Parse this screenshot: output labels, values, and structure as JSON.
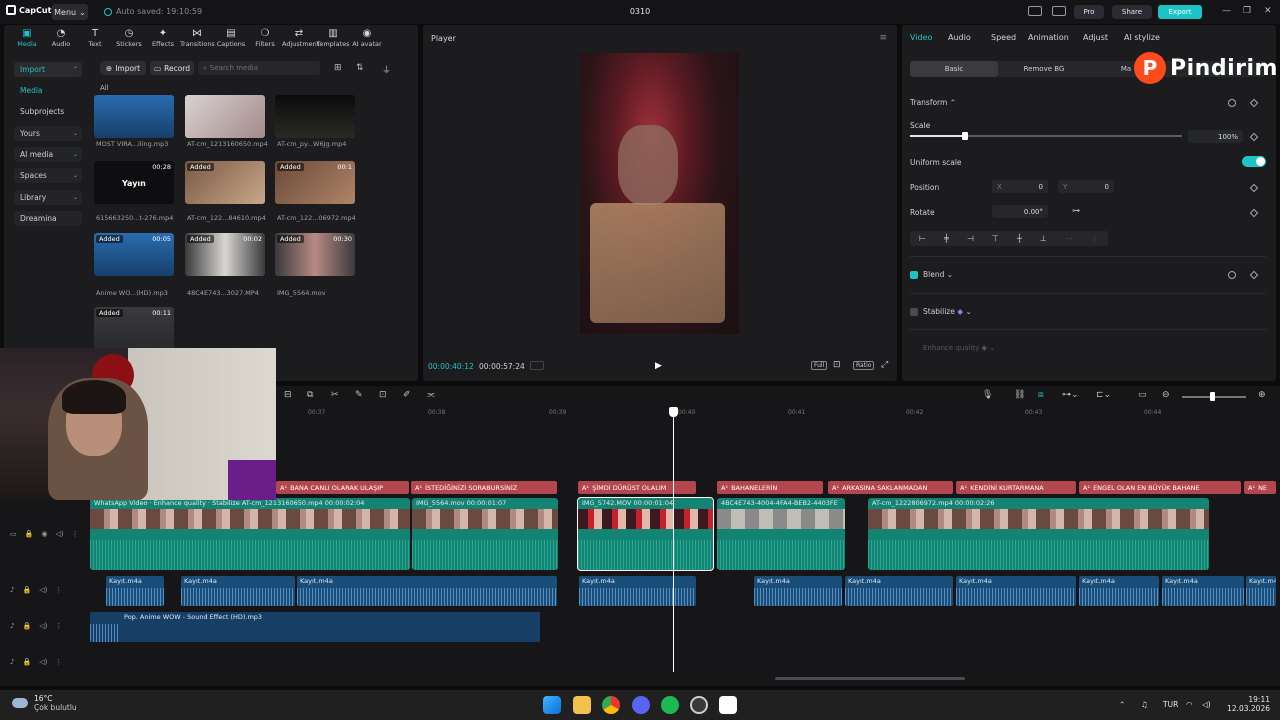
{
  "titlebar": {
    "app_name": "CapCut",
    "menu_label": "Menu",
    "autosave": "Auto saved: 19:10:59",
    "project_name": "0310",
    "pro_label": "Pro",
    "share_label": "Share",
    "export_label": "Export"
  },
  "media_tools": [
    {
      "label": "Media",
      "icon": "media-icon",
      "glyph": "▣"
    },
    {
      "label": "Audio",
      "icon": "audio-icon",
      "glyph": "◔"
    },
    {
      "label": "Text",
      "icon": "text-icon",
      "glyph": "T"
    },
    {
      "label": "Stickers",
      "icon": "stickers-icon",
      "glyph": "◷"
    },
    {
      "label": "Effects",
      "icon": "effects-icon",
      "glyph": "✦"
    },
    {
      "label": "Transitions",
      "icon": "transitions-icon",
      "glyph": "⋈"
    },
    {
      "label": "Captions",
      "icon": "captions-icon",
      "glyph": "▤"
    },
    {
      "label": "Filters",
      "icon": "filters-icon",
      "glyph": "❍"
    },
    {
      "label": "Adjustment",
      "icon": "adjustment-icon",
      "glyph": "⇄"
    },
    {
      "label": "Templates",
      "icon": "templates-icon",
      "glyph": "▥"
    },
    {
      "label": "AI avatar",
      "icon": "ai-avatar-icon",
      "glyph": "◉"
    }
  ],
  "sidebar": {
    "items": [
      {
        "label": "Import"
      },
      {
        "label": "Media"
      },
      {
        "label": "Subprojects"
      },
      {
        "label": "Yours"
      },
      {
        "label": "AI media"
      },
      {
        "label": "Spaces"
      },
      {
        "label": "Library"
      },
      {
        "label": "Dreamina"
      }
    ]
  },
  "media": {
    "import_label": "Import",
    "record_label": "Record",
    "search_placeholder": "Search media",
    "filter_all": "All",
    "items": [
      {
        "name": "MOST VIRA...iling.mp3",
        "badge": "",
        "duration": ""
      },
      {
        "name": "AT-cm_1213160650.mp4",
        "badge": "",
        "duration": ""
      },
      {
        "name": "AT-cm_py...W6Jg.mp4",
        "badge": "",
        "duration": ""
      },
      {
        "name": "615663250...t-276.mp4",
        "badge": "",
        "duration": "00:28"
      },
      {
        "name": "AT-cm_122...84610.mp4",
        "badge": "Added",
        "duration": ""
      },
      {
        "name": "AT-cm_122...06972.mp4",
        "badge": "Added",
        "duration": "00:1"
      },
      {
        "name": "Anime WO...(HD).mp3",
        "badge": "Added",
        "duration": "00:05"
      },
      {
        "name": "48C4E743...3027.MP4",
        "badge": "Added",
        "duration": "00:02"
      },
      {
        "name": "IMG_5564.mov",
        "badge": "Added",
        "duration": "00:30"
      },
      {
        "name": "",
        "badge": "Added",
        "duration": "00:11"
      }
    ],
    "thumb_text": "Yayın"
  },
  "player": {
    "title": "Player",
    "current_time": "00:00:40:12",
    "total_time": "00:00:57:24",
    "full_label": "Full",
    "ratio_label": "Ratio"
  },
  "props": {
    "tabs": [
      "Video",
      "Audio",
      "Speed",
      "Animation",
      "Adjust",
      "AI stylize"
    ],
    "subtabs": [
      "Basic",
      "Remove BG",
      "Ma"
    ],
    "transform_label": "Transform",
    "scale_label": "Scale",
    "scale_value": "100%",
    "scale_fraction": 0.2,
    "uniform_scale_label": "Uniform scale",
    "position_label": "Position",
    "pos_x_label": "X",
    "pos_x": "0",
    "pos_y_label": "Y",
    "pos_y": "0",
    "rotate_label": "Rotate",
    "rotate_value": "0.00°",
    "blend_label": "Blend",
    "stabilize_label": "Stabilize",
    "enhance_label": "Enhance quality"
  },
  "watermark": {
    "letter": "P",
    "text": "Pindirim"
  },
  "timeline": {
    "ruler": [
      "00:37",
      "00:38",
      "00:39",
      "00:40",
      "00:41",
      "00:42",
      "00:43",
      "00:44"
    ],
    "captions": [
      "BANA CANLI OLARAK ULAŞIP",
      "İSTEDİĞİNİZİ SORABURSİNİZ",
      "ŞİMDİ DÜRÜST OLALIM",
      "BAHANELERİN",
      "ARKASINA SAKLANMADAN",
      "KENDİNİ KURTARMANA",
      "ENGEL OLAN EN BÜYÜK BAHANE",
      "NE"
    ],
    "caption_prefix": "A¹",
    "video_clips": [
      {
        "label": "WhatsApp Video · Enhance quality · Stabilize  AT-cm_1213160650.mp4  00:00:02:04"
      },
      {
        "label": "IMG_5564.mov  00:00:01:07"
      },
      {
        "label": "IMG_5742.MOV  00:00:01:04"
      },
      {
        "label": "4BC4E743-4004-4FA4-BEB2-4403FE"
      },
      {
        "label": "AT-cm_1222806972.mp4  00:00:02:26"
      }
    ],
    "audio_clips": [
      {
        "label": "Kayıt.m4a"
      },
      {
        "label": "Kayıt.m4a"
      },
      {
        "label": "Kayıt.m4a"
      },
      {
        "label": "Kayıt.m4a"
      },
      {
        "label": "Kayıt.m4a"
      },
      {
        "label": "Kayıt.m4a"
      },
      {
        "label": "Kayıt.m4a"
      },
      {
        "label": "Kayıt.m4a"
      },
      {
        "label": "Kayıt.m4a"
      },
      {
        "label": "Kayıt.m4a"
      }
    ],
    "sfx_label": "Pop.  Anime WOW - Sound Effect (HD).mp3"
  },
  "taskbar": {
    "temperature": "16°C",
    "weather": "Çok bulutlu",
    "lang": "TUR",
    "time": "19:11",
    "date": "12.03.2026"
  },
  "colors": {
    "accent": "#1ec4c5",
    "caption": "#b4474d",
    "video_clip": "#138473",
    "audio_clip": "#1a4d78"
  }
}
